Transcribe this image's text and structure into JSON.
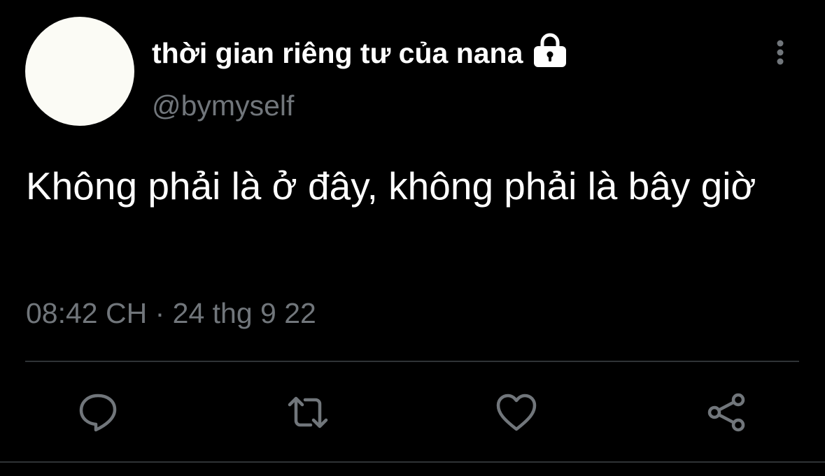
{
  "author": {
    "display_name": "thời gian riêng tư của nana",
    "handle": "@bymyself",
    "avatar_color": "#fbfbf5",
    "protected_icon": "lock-icon"
  },
  "tweet": {
    "text": "Không phải là ở đây, không phải là bây giờ",
    "timestamp": "08:42 CH · 24 thg 9 22"
  },
  "actions": [
    {
      "name": "reply",
      "icon": "comment-icon"
    },
    {
      "name": "retweet",
      "icon": "retweet-icon"
    },
    {
      "name": "like",
      "icon": "heart-icon"
    },
    {
      "name": "share",
      "icon": "share-icon"
    }
  ],
  "menu_icon": "more-vertical-icon",
  "colors": {
    "background": "#000000",
    "primary_text": "#ffffff",
    "secondary_text": "#71767b",
    "divider": "#2f3336"
  }
}
